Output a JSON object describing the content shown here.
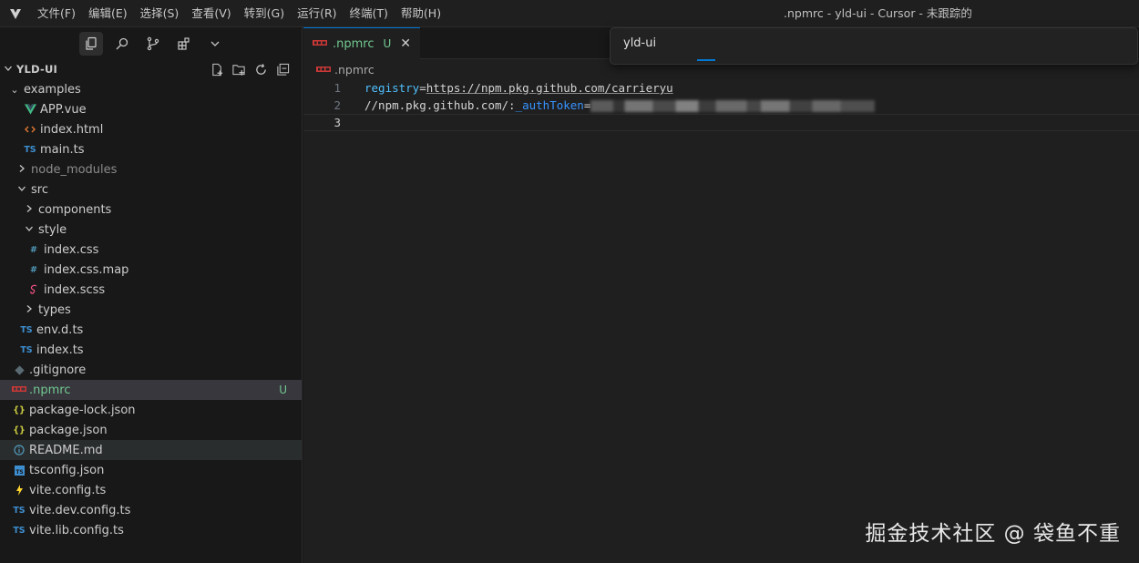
{
  "menubar": {
    "items": [
      "文件(F)",
      "编辑(E)",
      "选择(S)",
      "查看(V)",
      "转到(G)",
      "运行(R)",
      "终端(T)",
      "帮助(H)"
    ]
  },
  "window_title": ".npmrc - yld-ui - Cursor - 未跟踪的",
  "sidebar": {
    "toolbar_icons": [
      "files-icon",
      "search-icon",
      "source-control-icon",
      "extensions-icon",
      "chevron-down-icon"
    ],
    "root_label": "YLD-UI",
    "header_actions": [
      "new-file-icon",
      "new-folder-icon",
      "refresh-icon",
      "collapse-all-icon"
    ],
    "tree": [
      {
        "label": "examples",
        "type": "folder",
        "expanded": true,
        "depth": 0
      },
      {
        "label": "APP.vue",
        "type": "vue",
        "depth": 1
      },
      {
        "label": "index.html",
        "type": "html",
        "depth": 1
      },
      {
        "label": "main.ts",
        "type": "ts",
        "depth": 1
      },
      {
        "label": "node_modules",
        "type": "folder",
        "expanded": false,
        "depth": 0,
        "dim": true
      },
      {
        "label": "src",
        "type": "folder",
        "expanded": true,
        "depth": 0
      },
      {
        "label": "components",
        "type": "folder",
        "expanded": false,
        "depth": 1
      },
      {
        "label": "style",
        "type": "folder",
        "expanded": true,
        "depth": 1
      },
      {
        "label": "index.css",
        "type": "css",
        "depth": 2
      },
      {
        "label": "index.css.map",
        "type": "css",
        "depth": 2
      },
      {
        "label": "index.scss",
        "type": "scss",
        "depth": 2
      },
      {
        "label": "types",
        "type": "folder",
        "expanded": false,
        "depth": 1
      },
      {
        "label": "env.d.ts",
        "type": "ts",
        "depth": 1
      },
      {
        "label": "index.ts",
        "type": "ts",
        "depth": 1
      },
      {
        "label": ".gitignore",
        "type": "git",
        "depth": 0
      },
      {
        "label": ".npmrc",
        "type": "npm",
        "depth": 0,
        "selected": true,
        "badge": "U"
      },
      {
        "label": "package-lock.json",
        "type": "json",
        "depth": 0
      },
      {
        "label": "package.json",
        "type": "json",
        "depth": 0
      },
      {
        "label": "README.md",
        "type": "info",
        "depth": 0,
        "hover": true
      },
      {
        "label": "tsconfig.json",
        "type": "tsconfig",
        "depth": 0
      },
      {
        "label": "vite.config.ts",
        "type": "vite",
        "depth": 0
      },
      {
        "label": "vite.dev.config.ts",
        "type": "ts",
        "depth": 0
      },
      {
        "label": "vite.lib.config.ts",
        "type": "ts",
        "depth": 0
      }
    ]
  },
  "editor": {
    "tab": {
      "label": ".npmrc",
      "badge": "U",
      "close": "✕"
    },
    "breadcrumb": ".npmrc",
    "lines": [
      {
        "number": "1",
        "key": "registry",
        "eq": "=",
        "value": "https://npm.pkg.github.com/carrieryu"
      },
      {
        "number": "2",
        "prefix": "//npm.pkg.github.com/:",
        "var": "_authToken",
        "eq": "="
      },
      {
        "number": "3"
      }
    ]
  },
  "command_center": {
    "label": "yld-ui"
  },
  "watermark": "掘金技术社区 @ 袋鱼不重",
  "colors": {
    "accent": "#0078d4",
    "untracked": "#73c991",
    "background": "#1f1f1f",
    "sidebar": "#181818"
  }
}
